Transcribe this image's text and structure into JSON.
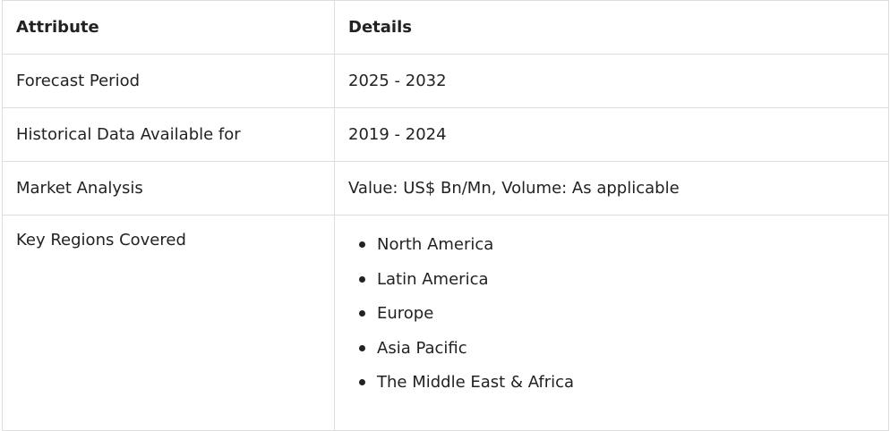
{
  "table": {
    "headers": [
      "Attribute",
      "Details"
    ],
    "rows": [
      {
        "attribute": "Forecast Period",
        "details": "2025 - 2032"
      },
      {
        "attribute": "Historical Data Available for",
        "details": "2019 - 2024"
      },
      {
        "attribute": "Market Analysis",
        "details": "Value: US$ Bn/Mn, Volume: As applicable"
      }
    ],
    "regions_row": {
      "attribute": "Key Regions Covered",
      "items": [
        "North America",
        "Latin America",
        "Europe",
        "Asia Pacific",
        "The Middle East & Africa"
      ]
    }
  }
}
